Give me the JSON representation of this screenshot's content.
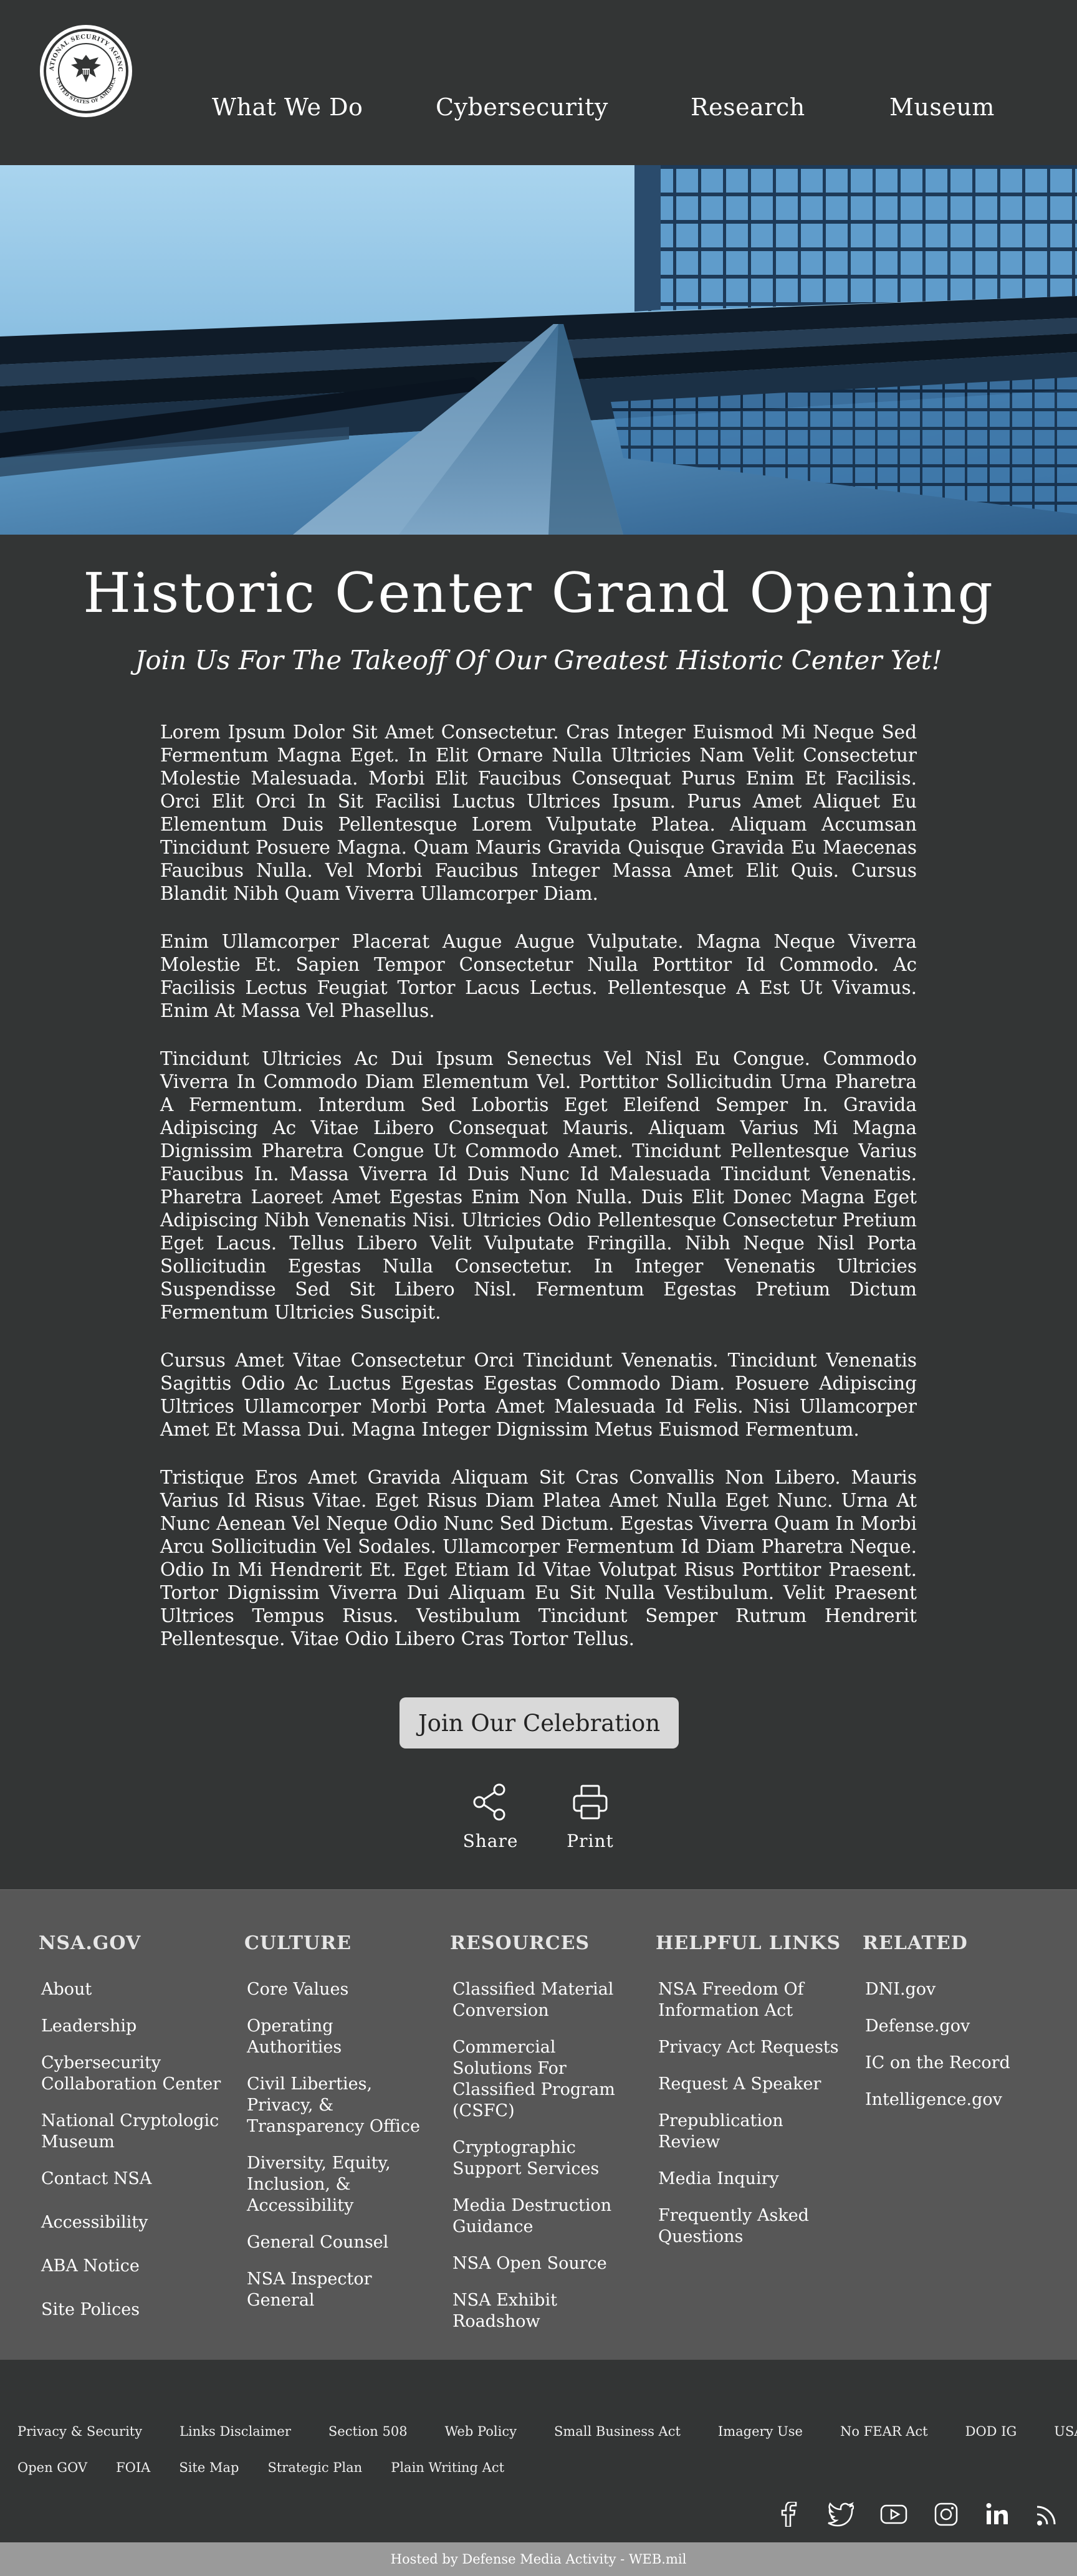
{
  "header": {
    "logo_alt": "National Security Agency - United States of America",
    "nav": [
      "What We Do",
      "Cybersecurity",
      "Research",
      "Museum"
    ]
  },
  "article": {
    "title": "Historic Center Grand Opening",
    "subtitle": "Join Us For The Takeoff Of Our Greatest Historic Center Yet!",
    "paragraphs": [
      "Lorem Ipsum Dolor Sit Amet Consectetur. Cras Integer Euismod Mi Neque Sed Fermentum Magna Eget. In Elit Ornare Nulla Ultricies Nam Velit Consectetur Molestie Malesuada. Morbi Elit Faucibus Consequat Purus Enim Et Facilisis. Orci Elit Orci In Sit Facilisi Luctus Ultrices Ipsum. Purus Amet Aliquet Eu Elementum Duis Pellentesque Lorem Vulputate Platea. Aliquam Accumsan Tincidunt Posuere Magna. Quam Mauris Gravida Quisque Gravida Eu Maecenas Faucibus Nulla. Vel Morbi Faucibus Integer Massa Amet Elit Quis. Cursus Blandit Nibh Quam Viverra Ullamcorper Diam.",
      "Enim Ullamcorper Placerat Augue Augue Vulputate. Magna Neque Viverra Molestie Et. Sapien Tempor Consectetur Nulla Porttitor Id Commodo. Ac Facilisis Lectus Feugiat Tortor Lacus Lectus. Pellentesque A Est Ut Vivamus. Enim At Massa Vel Phasellus.",
      "Tincidunt Ultricies Ac Dui Ipsum Senectus Vel Nisl Eu Congue. Commodo Viverra In Commodo Diam Elementum Vel. Porttitor Sollicitudin Urna Pharetra A Fermentum. Interdum Sed Lobortis Eget Eleifend Semper In. Gravida Adipiscing Ac Vitae Libero Consequat Mauris. Aliquam Varius Mi Magna Dignissim Pharetra Congue Ut Commodo Amet. Tincidunt Pellentesque Varius Faucibus In. Massa Viverra Id Duis Nunc Id Malesuada Tincidunt Venenatis. Pharetra Laoreet Amet Egestas Enim Non Nulla. Duis Elit Donec Magna Eget Adipiscing Nibh Venenatis Nisi. Ultricies Odio Pellentesque Consectetur Pretium Eget Lacus. Tellus Libero Velit Vulputate Fringilla. Nibh Neque Nisl Porta Sollicitudin Egestas Nulla Consectetur. In Integer Venenatis Ultricies Suspendisse Sed Sit Libero Nisl. Fermentum Egestas Pretium Dictum Fermentum Ultricies Suscipit.",
      "Cursus Amet Vitae Consectetur Orci Tincidunt Venenatis. Tincidunt Venenatis Sagittis Odio Ac Luctus Egestas Egestas Commodo Diam. Posuere Adipiscing Ultrices Ullamcorper Morbi Porta Amet Malesuada Id Felis. Nisi Ullamcorper Amet Et Massa Dui. Magna Integer Dignissim Metus Euismod Fermentum.",
      "Tristique Eros Amet Gravida Aliquam Sit Cras Convallis Non Libero. Mauris Varius Id Risus Vitae. Eget Risus Diam Platea Amet Nulla Eget Nunc. Urna At Nunc Aenean Vel Neque Odio Nunc Sed Dictum. Egestas Viverra Quam In Morbi Arcu Sollicitudin Vel Sodales. Ullamcorper Fermentum Id Diam Pharetra Neque. Odio In Mi Hendrerit Et. Eget Etiam Id Vitae Volutpat Risus Porttitor Praesent. Tortor Dignissim Viverra Dui Aliquam Eu Sit Nulla Vestibulum. Velit Praesent Ultrices Tempus Risus. Vestibulum Tincidunt Semper Rutrum Hendrerit Pellentesque. Vitae Odio Libero Cras Tortor Tellus."
    ],
    "cta_label": "Join Our Celebration",
    "share_label": "Share",
    "print_label": "Print"
  },
  "footer": {
    "columns": [
      {
        "heading": "NSA.GOV",
        "links": [
          "About",
          "Leadership",
          "Cybersecurity Collaboration Center",
          "National Cryptologic Museum",
          "Contact NSA",
          "Accessibility",
          "ABA Notice",
          "Site Polices"
        ]
      },
      {
        "heading": "CULTURE",
        "links": [
          "Core Values",
          "Operating Authorities",
          "Civil Liberties, Privacy, & Transparency Office",
          "Diversity, Equity, Inclusion, & Accessibility",
          "General Counsel",
          "NSA Inspector General"
        ]
      },
      {
        "heading": "RESOURCES",
        "links": [
          "Classified Material Conversion",
          "Commercial Solutions For Classified Program (CSFC)",
          "Cryptographic Support Services",
          "Media Destruction Guidance",
          "NSA Open Source",
          "NSA Exhibit Roadshow"
        ]
      },
      {
        "heading": "HELPFUL LINKS",
        "links": [
          "NSA Freedom Of Information Act",
          "Privacy Act Requests",
          "Request A Speaker",
          "Prepublication Review",
          "Media Inquiry",
          "Frequently Asked Questions"
        ]
      },
      {
        "heading": "RELATED",
        "links": [
          "DNI.gov",
          "Defense.gov",
          "IC on the Record",
          "Intelligence.gov"
        ]
      }
    ],
    "legal_row1": [
      "Privacy & Security",
      "Links Disclaimer",
      "Section 508",
      "Web Policy",
      "Small Business Act",
      "Imagery Use",
      "No FEAR Act",
      "DOD IG",
      "USA.gov"
    ],
    "legal_row2": [
      "Open GOV",
      "FOIA",
      "Site Map",
      "Strategic Plan",
      "Plain Writing Act"
    ],
    "social_icons": [
      "facebook-icon",
      "twitter-icon",
      "youtube-icon",
      "instagram-icon",
      "linkedin-icon",
      "rss-icon"
    ],
    "hosted_by": "Hosted by Defense Media Activity - WEB.mil"
  }
}
